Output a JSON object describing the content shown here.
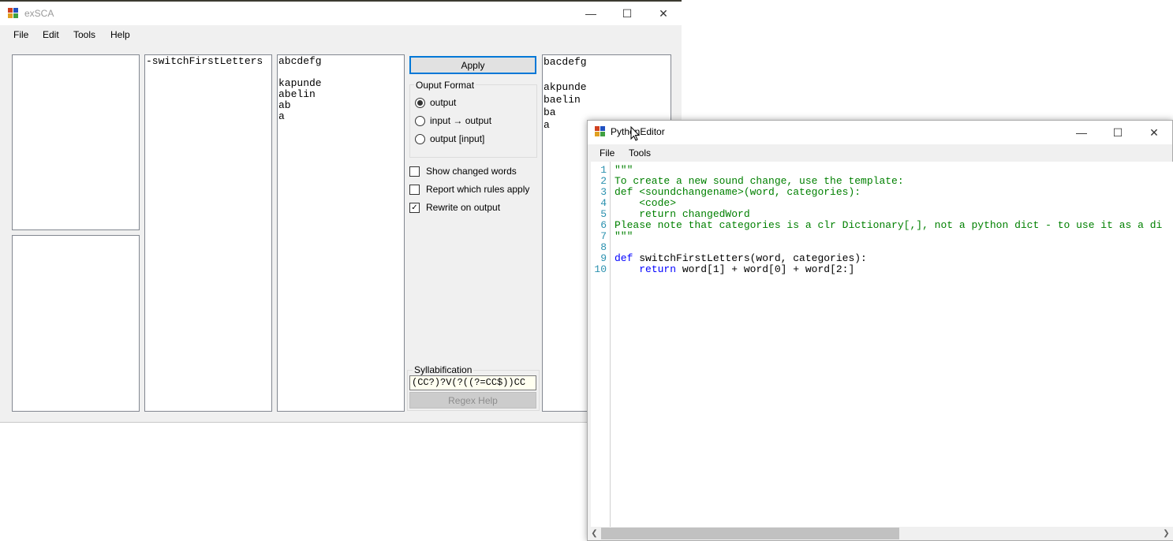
{
  "main_window": {
    "title": "exSCA",
    "menu": [
      "File",
      "Edit",
      "Tools",
      "Help"
    ],
    "rules_text": "-switchFirstLetters",
    "input_text": "abcdefg\n\nkapunde\nabelin\nab\na",
    "output_text": "bacdefg\n\nakpunde\nbaelin\nba\na",
    "apply_label": "Apply",
    "output_format": {
      "label": "Ouput Format",
      "options": [
        "output",
        "input → output",
        "output [input]"
      ],
      "selected": "output"
    },
    "checkboxes": [
      {
        "label": "Show changed words",
        "checked": false
      },
      {
        "label": "Report which rules apply",
        "checked": false
      },
      {
        "label": "Rewrite on output",
        "checked": true
      }
    ],
    "syllabification": {
      "label": "Syllabification",
      "value": "(CC?)?V(?((?=CC$))CC"
    },
    "regex_help_label": "Regex Help"
  },
  "python_editor": {
    "title": "PythonEditor",
    "menu": [
      "File",
      "Tools"
    ],
    "line_numbers": [
      "1",
      "2",
      "3",
      "4",
      "5",
      "6",
      "7",
      "8",
      "9",
      "10"
    ],
    "lines": [
      "\"\"\"",
      "To create a new sound change, use the template:",
      "def <soundchangename>(word, categories):",
      "    <code>",
      "    return changedWord",
      "Please note that categories is a clr Dictionary[,], not a python dict - to use it as a di",
      "\"\"\"",
      "",
      "def switchFirstLetters(word, categories):",
      "    return word[1] + word[0] + word[2:]"
    ]
  },
  "colors": {
    "comment": "#008000",
    "keyword": "#0000ff",
    "line_number": "#2b91af",
    "accent": "#0078d7"
  }
}
